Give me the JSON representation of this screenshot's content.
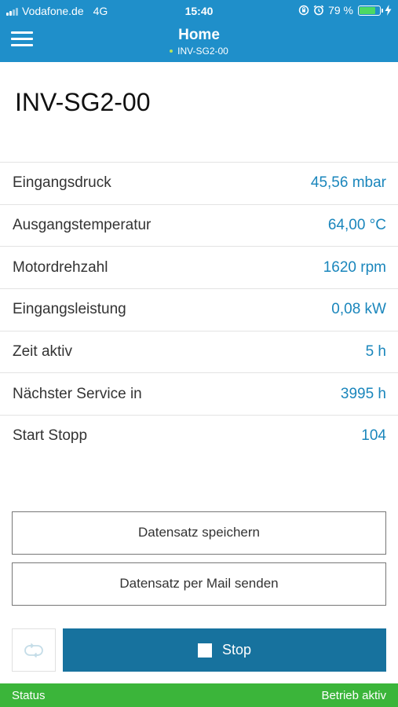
{
  "statusbar": {
    "carrier": "Vodafone.de",
    "network": "4G",
    "time": "15:40",
    "battery_text": "79 %",
    "battery_level": 0.79
  },
  "navbar": {
    "title": "Home",
    "subtitle": "INV-SG2-00"
  },
  "device": {
    "name": "INV-SG2-00"
  },
  "params": [
    {
      "label": "Eingangsdruck",
      "value": "45,56 mbar"
    },
    {
      "label": "Ausgangstemperatur",
      "value": "64,00 °C"
    },
    {
      "label": "Motordrehzahl",
      "value": "1620 rpm"
    },
    {
      "label": "Eingangsleistung",
      "value": "0,08 kW"
    },
    {
      "label": "Zeit aktiv",
      "value": "5 h"
    },
    {
      "label": "Nächster Service in",
      "value": "3995 h"
    },
    {
      "label": "Start Stopp",
      "value": "104"
    }
  ],
  "actions": {
    "save_label": "Datensatz speichern",
    "mail_label": "Datensatz per Mail senden",
    "stop_label": "Stop"
  },
  "footer": {
    "status_label": "Status",
    "status_value": "Betrieb aktiv"
  },
  "colors": {
    "header": "#1f8fca",
    "accent_value": "#1a86bc",
    "stop_button": "#17729e",
    "status_strip": "#3bb53a"
  },
  "icons": {
    "menu": "hamburger-menu-icon",
    "refresh": "refresh-cycle-icon",
    "stop": "stop-square-icon"
  }
}
